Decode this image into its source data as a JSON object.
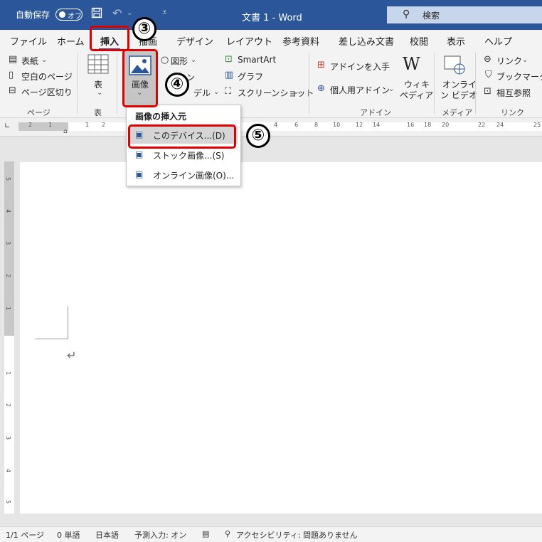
{
  "titlebar": {
    "autosave_label": "自動保存",
    "autosave_state": "オフ",
    "doc_title": "文書 1  -  Word",
    "search_placeholder": "検索",
    "brand_color": "#2b579a"
  },
  "tabs": [
    "ファイル",
    "ホーム",
    "挿入",
    "描画",
    "デザイン",
    "レイアウト",
    "参考資料",
    "差し込み文書",
    "校閲",
    "表示",
    "ヘルプ"
  ],
  "active_tab": "挿入",
  "ribbon": {
    "pages": {
      "items": [
        "表紙",
        "空白のページ",
        "ページ区切り"
      ],
      "group_label": "ページ"
    },
    "table": {
      "button": "表",
      "group_label": "表"
    },
    "illustrations": {
      "picture_button": "画像",
      "shapes": "図形",
      "icons_partial": "ン",
      "models_partial": "デル"
    },
    "smartart": {
      "smartart": "SmartArt",
      "chart": "グラフ",
      "screenshot": "スクリーンショット"
    },
    "addins": {
      "get_addins": "アドインを入手",
      "my_addins": "個人用アドイン",
      "wiki_line1": "ウィキ",
      "wiki_line2": "ペディア",
      "group_label": "アドイン"
    },
    "media": {
      "line1": "オンライ",
      "line2": "ン ビデオ",
      "group_label": "メディア"
    },
    "links": {
      "link": "リンク",
      "bookmark": "ブックマーク",
      "cross_ref": "相互参照",
      "group_label": "リンク"
    }
  },
  "ruler_numbers": [
    "2",
    "1",
    "1",
    "2",
    "4",
    "6",
    "8",
    "10",
    "12",
    "14",
    "16",
    "18",
    "20",
    "22",
    "24",
    "25"
  ],
  "vruler_numbers": [
    "5",
    "4",
    "3",
    "2",
    "1",
    "1",
    "2",
    "3",
    "4",
    "5"
  ],
  "menu": {
    "title": "画像の挿入元",
    "items": [
      "このデバイス...(D)",
      "ストック画像...(S)",
      "オンライン画像(O)..."
    ]
  },
  "annotations": {
    "step3": "③",
    "step4": "④",
    "step5": "⑤",
    "highlight_color": "#e00000"
  },
  "statusbar": {
    "page": "1/1 ページ",
    "words": "0 単語",
    "language": "日本語",
    "predict": "予測入力: オン",
    "accessibility": "アクセシビリティ: 問題ありません"
  },
  "icons": [
    "save-icon",
    "undo-icon",
    "redo-icon",
    "customize-icon",
    "search-icon",
    "picture-icon",
    "table-icon",
    "paragraph-mark-icon"
  ]
}
